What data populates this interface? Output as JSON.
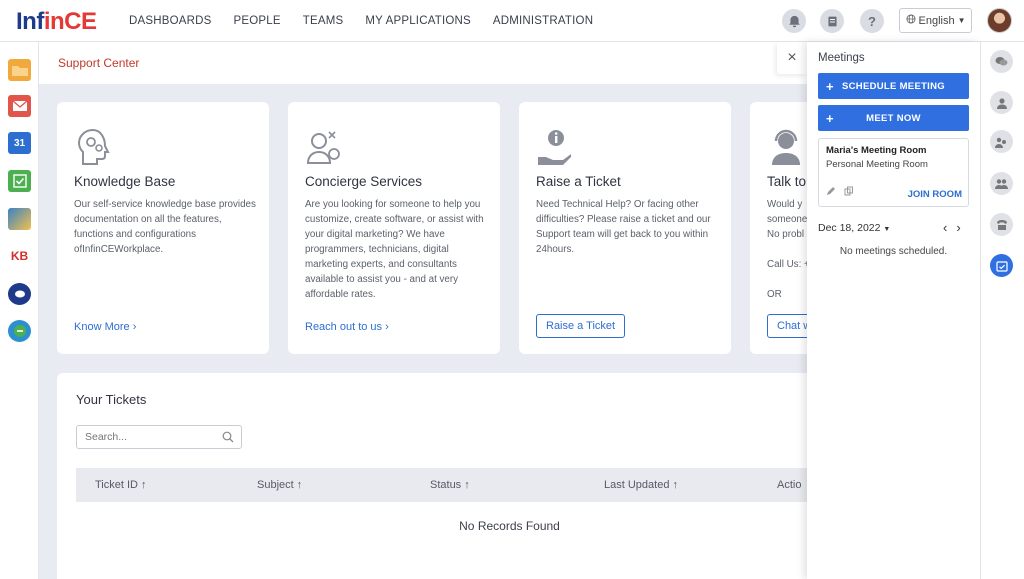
{
  "app": {
    "logo_part1": "Inf",
    "logo_part2": "in",
    "logo_part3": "CE"
  },
  "nav": [
    "DASHBOARDS",
    "PEOPLE",
    "TEAMS",
    "MY APPLICATIONS",
    "ADMINISTRATION"
  ],
  "header": {
    "language": "English"
  },
  "left_rail_apps": [
    {
      "name": "folder-app-icon",
      "color": "#f2a93b",
      "label": ""
    },
    {
      "name": "mail-app-icon",
      "color": "#e1554a",
      "label": ""
    },
    {
      "name": "calendar-app-icon",
      "color": "#2d6fd0",
      "label": "31"
    },
    {
      "name": "tasks-app-icon",
      "color": "#4caf50",
      "label": ""
    },
    {
      "name": "photos-app-icon",
      "color": "#3b82c4",
      "label": ""
    },
    {
      "name": "kb-app-icon",
      "color": "#ffffff",
      "label": "KB"
    },
    {
      "name": "chat-app-icon",
      "color": "#1e3a8a",
      "label": ""
    },
    {
      "name": "support-app-icon",
      "color": "#2d8fd0",
      "label": ""
    }
  ],
  "breadcrumb": "Support Center",
  "cards": [
    {
      "icon": "head-gears-icon",
      "title": "Knowledge Base",
      "description": "Our self-service knowledge base provides documentation on all the features, functions and configurations ofInfinCEWorkplace.",
      "link": "Know More"
    },
    {
      "icon": "concierge-icon",
      "title": "Concierge Services",
      "description": "Are you looking for someone to help you customize, create software, or assist with your digital marketing? We have programmers, technicians, digital marketing experts, and consultants available to assist you - and at very affordable rates.",
      "link": "Reach out to us"
    },
    {
      "icon": "hand-info-icon",
      "title": "Raise a Ticket",
      "description": "Need Technical Help? Or facing other difficulties? Please raise a ticket and our Support team will get back to you within 24hours.",
      "button": "Raise a Ticket"
    },
    {
      "icon": "agent-headset-icon",
      "title": "Talk to",
      "description": "Would y someone No probl",
      "call": "Call Us: +",
      "or": "OR",
      "button": "Chat w"
    }
  ],
  "tickets": {
    "title": "Your Tickets",
    "search_placeholder": "Search...",
    "columns": [
      "Ticket ID ↑",
      "Subject ↑",
      "Status ↑",
      "Last Updated ↑",
      "Actio"
    ],
    "empty": "No Records Found"
  },
  "meetings": {
    "close": "×",
    "title": "Meetings",
    "schedule_label": "SCHEDULE MEETING",
    "meet_now_label": "MEET NOW",
    "plus": "+",
    "room_name": "Maria's Meeting Room",
    "room_type": "Personal Meeting Room",
    "join_label": "JOIN ROOM",
    "date": "Dec 18, 2022",
    "empty": "No meetings scheduled."
  },
  "right_rail": [
    "chat-bubbles-icon",
    "person-icon",
    "people-pair-icon",
    "group-icon",
    "phone-icon",
    "calendar-check-icon"
  ]
}
